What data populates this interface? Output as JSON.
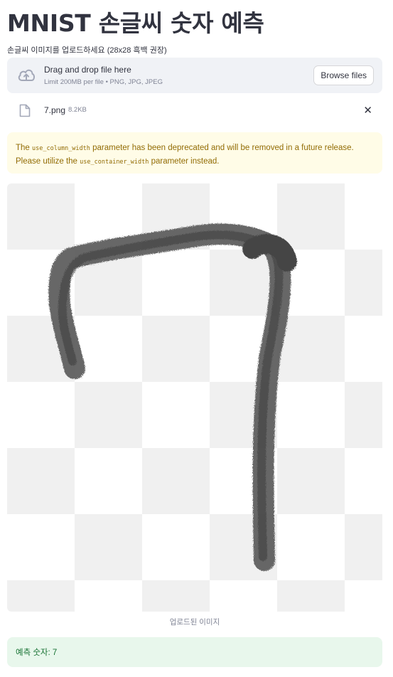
{
  "page": {
    "title": "MNIST 손글씨 숫자 예측"
  },
  "uploader": {
    "label": "손글씨 이미지를 업로드하세요 (28x28 흑백 권장)",
    "drop_title": "Drag and drop file here",
    "limit_text": "Limit 200MB per file • PNG, JPG, JPEG",
    "browse_label": "Browse files",
    "cloud_icon": "cloud-upload-icon"
  },
  "file": {
    "name": "7.png",
    "size": "8.2KB",
    "file_icon": "file-icon",
    "close_icon": "close-icon",
    "close_glyph": "✕"
  },
  "warning": {
    "text_1": "The ",
    "code_1": "use_column_width",
    "text_2": " parameter has been deprecated and will be removed in a future release. Please utilize the ",
    "code_2": "use_container_width",
    "text_3": " parameter instead."
  },
  "image": {
    "caption": "업로드된 이미지",
    "digit": "7"
  },
  "result": {
    "text": "예측 숫자: 7"
  },
  "colors": {
    "text": "#31333f",
    "muted": "#808495",
    "dropzone_bg": "#f0f2f6",
    "warning_bg": "#fffce7",
    "warning_text": "#926c05",
    "success_bg": "#e8f7ec",
    "success_text": "#177233",
    "stroke": "#5a5a5a"
  }
}
